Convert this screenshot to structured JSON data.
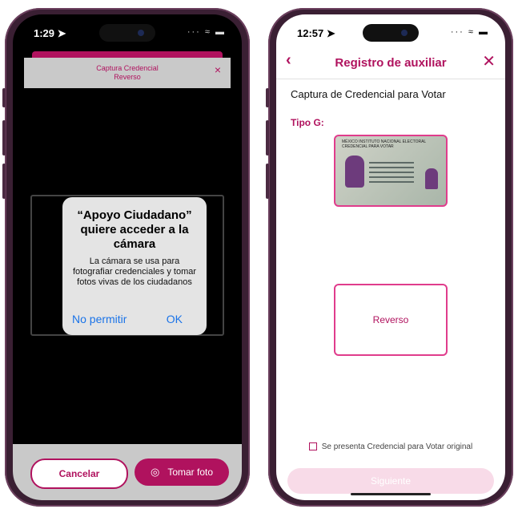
{
  "left": {
    "status": {
      "time": "1:29 ➤",
      "icons": "···  ≈  ▬"
    },
    "header": {
      "line1": "Captura Credencial",
      "line2": "Reverso",
      "close": "×"
    },
    "alert": {
      "title": "“Apoyo Ciudadano” quiere acceder a la cámara",
      "message": "La cámara se usa para fotografiar credenciales y tomar fotos vivas de los ciudadanos",
      "deny": "No permitir",
      "ok": "OK"
    },
    "buttons": {
      "cancel": "Cancelar",
      "photo": "Tomar foto",
      "camera_icon": "◎"
    }
  },
  "right": {
    "status": {
      "time": "12:57 ➤",
      "icons": "···  ≈  ▬"
    },
    "nav": {
      "back": "‹",
      "title": "Registro de auxiliar",
      "close": "✕"
    },
    "subtitle": "Captura de Credencial para Votar",
    "tipo": "Tipo G:",
    "card_header": "MÉXICO  INSTITUTO NACIONAL ELECTORAL  CREDENCIAL PARA VOTAR",
    "reverso_label": "Reverso",
    "checkbox_label": "Se presenta Credencial para Votar original",
    "next": "Siguiente"
  },
  "colors": {
    "accent": "#b0125e",
    "accent_light": "#f8dbe8",
    "link_blue": "#1a73e8"
  }
}
